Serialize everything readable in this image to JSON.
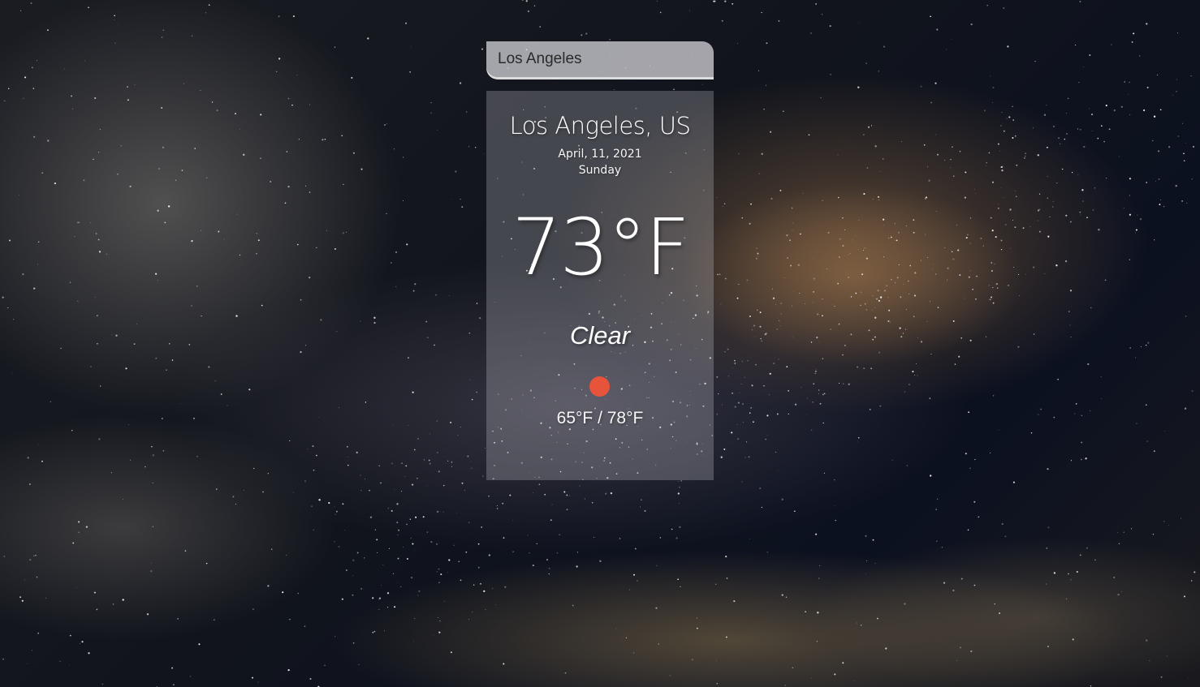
{
  "search": {
    "value": "Los Angeles"
  },
  "weather": {
    "location": "Los Angeles, US",
    "date": "April, 11, 2021",
    "day": "Sunday",
    "temperature": "73°F",
    "condition": "Clear",
    "icon": "sun-icon",
    "hi_lo": "65°F / 78°F"
  },
  "colors": {
    "sun_icon": "#e8533c",
    "text": "#ffffff"
  }
}
